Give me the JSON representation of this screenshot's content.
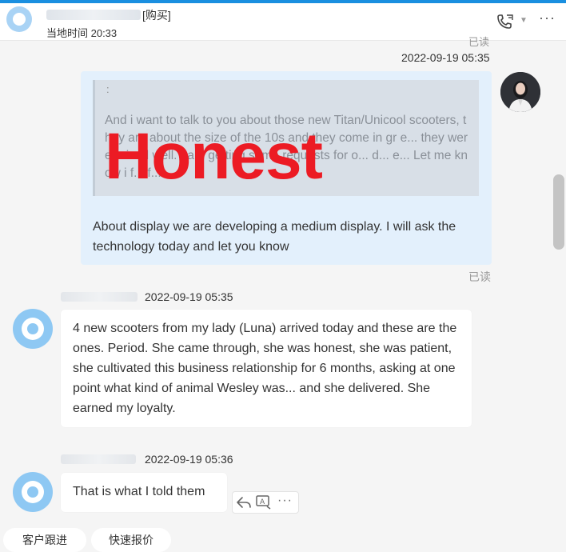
{
  "header": {
    "tag": "[购买]",
    "local_time": "当地时间 20:33",
    "accent_color": "#1a8fe0"
  },
  "messages": {
    "read_top": "已读",
    "outgoing": {
      "timestamp": "2022-09-19 05:35",
      "quote_mark": ":",
      "quote_text": "And i want to talk to you about those new Titan/Unicool scooters, they are about the size of the 10s and they come in gr e... they were priced well. I am getting some requests for o... d... e... Let me know i f... f...",
      "reply_text": "About display we are developing a medium display. I will ask the technology today and let you know",
      "read_status": "已读"
    },
    "incoming": [
      {
        "timestamp": "2022-09-19 05:35",
        "text": "4 new scooters from my lady (Luna) arrived today and these are the ones. Period. She came through, she was honest, she was patient, she cultivated this business relationship for 6 months, asking at one point what kind of animal Wesley was... and she delivered. She earned my loyalty."
      },
      {
        "timestamp": "2022-09-19 05:36",
        "text": "That is what I told them"
      }
    ]
  },
  "overlay": {
    "text": "Honest",
    "color": "#ec1b24"
  },
  "bottom_bar": {
    "button1": "客户跟进",
    "button2": "快速报价"
  }
}
